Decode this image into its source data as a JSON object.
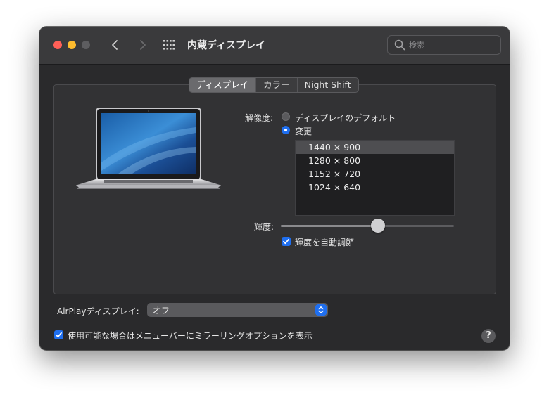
{
  "window": {
    "title": "内蔵ディスプレイ",
    "search_placeholder": "検索"
  },
  "tabs": [
    {
      "label": "ディスプレイ",
      "active": true
    },
    {
      "label": "カラー",
      "active": false
    },
    {
      "label": "Night Shift",
      "active": false
    }
  ],
  "resolution": {
    "label": "解像度:",
    "options": [
      {
        "label": "ディスプレイのデフォルト",
        "selected": false
      },
      {
        "label": "変更",
        "selected": true
      }
    ],
    "list": [
      {
        "text": "1440 × 900",
        "selected": true
      },
      {
        "text": "1280 × 800",
        "selected": false
      },
      {
        "text": "1152 × 720",
        "selected": false
      },
      {
        "text": "1024 × 640",
        "selected": false
      }
    ]
  },
  "brightness": {
    "label": "輝度:",
    "level_percent": 56,
    "auto_label": "輝度を自動調節",
    "auto_checked": true
  },
  "airplay": {
    "label": "AirPlayディスプレイ:",
    "value": "オフ"
  },
  "mirroring": {
    "label": "使用可能な場合はメニューバーにミラーリングオプションを表示",
    "checked": true
  },
  "help_label": "?",
  "colors": {
    "accent": "#1f6ff0",
    "close": "#ff5f57",
    "minimize": "#febc2e"
  }
}
